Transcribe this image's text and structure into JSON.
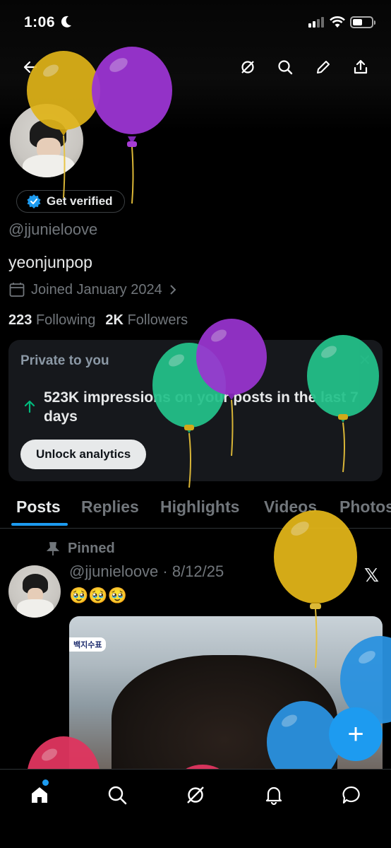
{
  "status_bar": {
    "time": "1:06"
  },
  "profile": {
    "verify_label": "Get verified",
    "handle": "@jjunieloove",
    "display_name": "yeonjunpop",
    "joined": "Joined January 2024",
    "following_count": "223",
    "following_label": "Following",
    "followers_count": "2K",
    "followers_label": "Followers"
  },
  "analytics_card": {
    "title": "Private to you",
    "close": "✕",
    "text": "523K impressions on your posts in the last 7 days",
    "button": "Unlock analytics"
  },
  "tabs": [
    "Posts",
    "Replies",
    "Highlights",
    "Videos",
    "Photos"
  ],
  "active_tab": "Posts",
  "post": {
    "pinned_label": "Pinned",
    "meta": "@jjunieloove · 8/12/25",
    "text": "🥹🥹🥹",
    "media_label": "백지수표"
  },
  "fab_label": "+",
  "colors": {
    "accent": "#1d9bf0",
    "background": "#000000",
    "card": "#16181c",
    "muted_text": "#71767b",
    "balloon_yellow": "#e0b419",
    "balloon_purple": "#9b35d2",
    "balloon_green": "#23c28a",
    "balloon_blue": "#2a92e0",
    "balloon_pink": "#e0355f"
  },
  "icons": {
    "top_bar": [
      "back-arrow-icon",
      "grok-icon",
      "search-icon",
      "compose-icon",
      "share-icon"
    ],
    "bottom_nav": [
      "home-icon",
      "search-icon",
      "grok-icon",
      "notifications-icon",
      "messages-icon"
    ]
  }
}
